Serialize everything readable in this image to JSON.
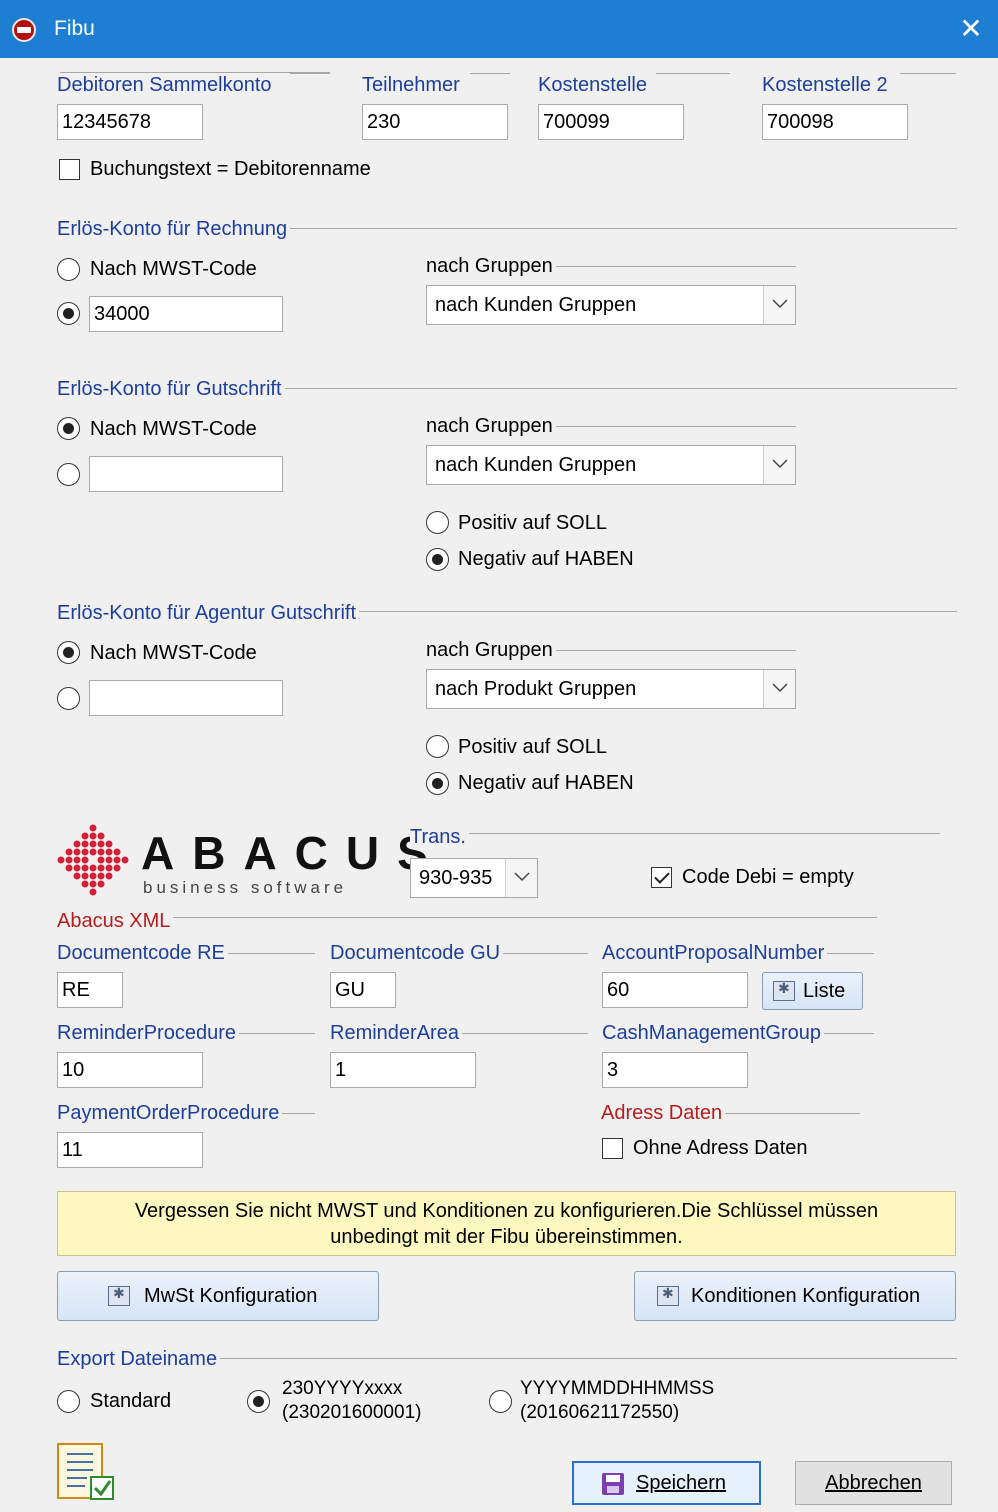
{
  "window": {
    "title": "Fibu",
    "close_label": "✕"
  },
  "top": {
    "debitoren_label": "Debitoren Sammelkonto",
    "debitoren_value": "12345678",
    "teilnehmer_label": "Teilnehmer",
    "teilnehmer_value": "230",
    "kostenstelle_label": "Kostenstelle",
    "kostenstelle_value": "700099",
    "kostenstelle2_label": "Kostenstelle 2",
    "kostenstelle2_value": "700098",
    "buchungstext_label": "Buchungstext = Debitorenname",
    "buchungstext_checked": false
  },
  "rechnung": {
    "title": "Erlös-Konto für Rechnung",
    "mwst_label": "Nach MWST-Code",
    "mwst_selected": false,
    "konto_selected": true,
    "konto_value": "34000",
    "gruppen_label": "nach Gruppen",
    "gruppen_value": "nach Kunden Gruppen"
  },
  "gutschrift": {
    "title": "Erlös-Konto für Gutschrift",
    "mwst_label": "Nach MWST-Code",
    "mwst_selected": true,
    "konto_selected": false,
    "konto_value": "",
    "gruppen_label": "nach Gruppen",
    "gruppen_value": "nach Kunden Gruppen",
    "positiv_label": "Positiv auf SOLL",
    "negativ_label": "Negativ auf HABEN",
    "negativ_selected": true
  },
  "agentur": {
    "title": "Erlös-Konto für Agentur Gutschrift",
    "mwst_label": "Nach MWST-Code",
    "mwst_selected": true,
    "konto_selected": false,
    "konto_value": "",
    "gruppen_label": "nach Gruppen",
    "gruppen_value": "nach Produkt Gruppen",
    "positiv_label": "Positiv auf SOLL",
    "negativ_label": "Negativ auf HABEN",
    "negativ_selected": true
  },
  "abacus": {
    "logo_word": "ABACUS",
    "logo_tagline": "business software",
    "trans_label": "Trans.",
    "trans_value": "930-935",
    "code_debi_label": "Code Debi = empty",
    "code_debi_checked": true,
    "xml_title": "Abacus XML",
    "doc_re_label": "Documentcode RE",
    "doc_re_value": "RE",
    "doc_gu_label": "Documentcode GU",
    "doc_gu_value": "GU",
    "account_label": "AccountProposalNumber",
    "account_value": "60",
    "liste_label": "Liste",
    "reminder_proc_label": "ReminderProcedure",
    "reminder_proc_value": "10",
    "reminder_area_label": "ReminderArea",
    "reminder_area_value": "1",
    "cash_label": "CashManagementGroup",
    "cash_value": "3",
    "payment_label": "PaymentOrderProcedure",
    "payment_value": "11",
    "adress_title": "Adress Daten",
    "ohne_adress_label": "Ohne Adress Daten",
    "ohne_adress_checked": false
  },
  "note": {
    "line1": "Vergessen Sie nicht MWST und Konditionen zu konfigurieren.Die Schlüssel müssen",
    "line2": "unbedingt mit der Fibu übereinstimmen."
  },
  "buttons": {
    "mwst": "MwSt Konfiguration",
    "konditionen": "Konditionen Konfiguration",
    "speichern": "Speichern",
    "abbrechen": "Abbrechen"
  },
  "export": {
    "title": "Export Dateiname",
    "standard_label": "Standard",
    "opt2_line1": "230YYYYxxxx",
    "opt2_line2": "(230201600001)",
    "opt2_selected": true,
    "opt3_line1": "YYYYMMDDHHMMSS",
    "opt3_line2": "(20160621172550)"
  },
  "colors": {
    "titlebar": "#1e7fd2",
    "label_blue": "#1d3e9c",
    "label_red": "#b71c1c",
    "note_bg": "#fcf8c0",
    "logo_red": "#d2213a"
  },
  "icons": [
    "app-icon",
    "close-icon",
    "chevron-down-icon",
    "gear-icon",
    "floppy-disk-icon",
    "checklist-icon",
    "abacus-logo"
  ]
}
